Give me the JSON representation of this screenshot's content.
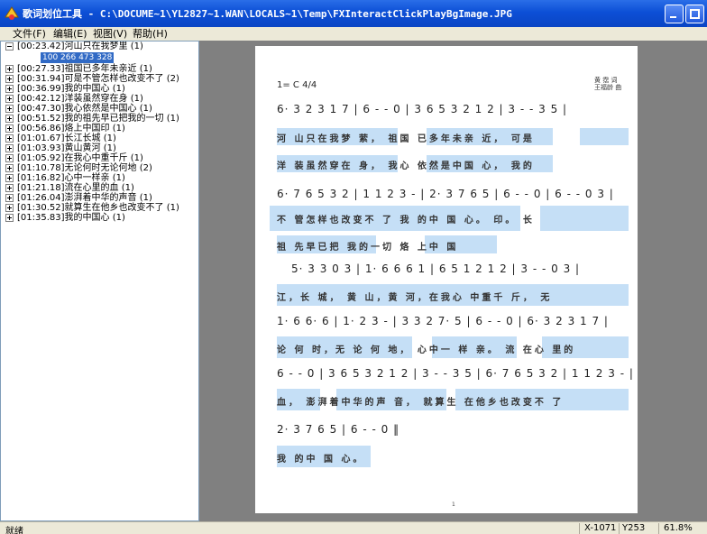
{
  "window": {
    "title": "歌词划位工具 - C:\\DOCUME~1\\YL2827~1.WAN\\LOCALS~1\\Temp\\FXInteractClickPlayBgImage.JPG"
  },
  "menu": [
    "文件(F)",
    "编辑(E)",
    "视图(V)",
    "帮助(H)"
  ],
  "tree": {
    "items": [
      {
        "label": "[00:23.42]河山只在我梦里 (1)",
        "expanded": true
      },
      {
        "label": "[00:27.33]祖国已多年未亲近 (1)",
        "expanded": false
      },
      {
        "label": "[00:31.94]可是不管怎样也改变不了 (2)",
        "expanded": false
      },
      {
        "label": "[00:36.99]我的中国心 (1)",
        "expanded": false
      },
      {
        "label": "[00:42.12]洋装虽然穿在身 (1)",
        "expanded": false
      },
      {
        "label": "[00:47.30]我心依然是中国心 (1)",
        "expanded": false
      },
      {
        "label": "[00:51.52]我的祖先早已把我的一切 (1)",
        "expanded": false
      },
      {
        "label": "[00:56.86]烙上中国印 (1)",
        "expanded": false
      },
      {
        "label": "[01:01.67]长江长城 (1)",
        "expanded": false
      },
      {
        "label": "[01:03.93]黄山黄河 (1)",
        "expanded": false
      },
      {
        "label": "[01:05.92]在我心中重千斤 (1)",
        "expanded": false
      },
      {
        "label": "[01:10.78]无论何时无论何地 (2)",
        "expanded": false
      },
      {
        "label": "[01:16.82]心中一样亲 (1)",
        "expanded": false
      },
      {
        "label": "[01:21.18]流在心里的血 (1)",
        "expanded": false
      },
      {
        "label": "[01:26.04]澎湃着中华的声音 (1)",
        "expanded": false
      },
      {
        "label": "[01:30.52]就算生在他乡也改变不了 (1)",
        "expanded": false
      },
      {
        "label": "[01:35.83]我的中国心 (1)",
        "expanded": false
      }
    ],
    "selected_child": "100 266 473 328"
  },
  "score": {
    "key": "1= C 4/4",
    "credit_line1": "黄 霑 词",
    "credit_line2": "王福龄 曲",
    "page_number": "1",
    "notation": [
      "6· 3 2 3 1 7 | 6 - - 0 | 3 6 5 3 2 1 2 | 3 - - 3 5 |",
      "6· 7 6 5 3 2 | 1 1 2 3 - | 2· 3 7 6 5 | 6 - - 0 | 6 - - 0 3 |",
      "5· 3 3 0 3 | 1· 6 6 6 1 | 6 5 1 2 1 2 | 3 - - 0 3 |",
      "1· 6 6· 6 | 1· 2 3 - | 3 3 2 7· 5 | 6 - - 0 | 6· 3 2 3 1 7 |",
      "6 - - 0 | 3 6 5 3 2 1 2 | 3 - - 3 5 | 6· 7 6 5 3 2 | 1 1 2 3 - |",
      "2· 3 7 6 5 | 6 - - 0 ‖"
    ],
    "lyrics": [
      "河  山只在我梦  萦，    祖国 已多年未亲  近，    可是",
      "洋  装虽然穿在  身，    我心 依然是中国  心，    我的",
      "不  管怎样也改变不  了    我 的中 国  心。      印。    长",
      "祖  先早已把   我的一切    烙 上中 国",
      "江，长 城，  黄  山，黄 河，在我心 中重千    斤，        无",
      "论 何 时，无 论 何 地，    心中一 样 亲。      流 在心 里的",
      "血，      澎湃着中华的声  音，  就算生 在他乡也改变不 了",
      "我 的中 国  心。"
    ]
  },
  "status": {
    "left": "就绪",
    "x": "X-1071",
    "y": "Y253",
    "zoom": "61.8%"
  },
  "colors": {
    "titlebar": "#0c4fd6",
    "highlight": "#c5dff6",
    "selection": "#316ac5",
    "viewer_bg": "#808080"
  }
}
